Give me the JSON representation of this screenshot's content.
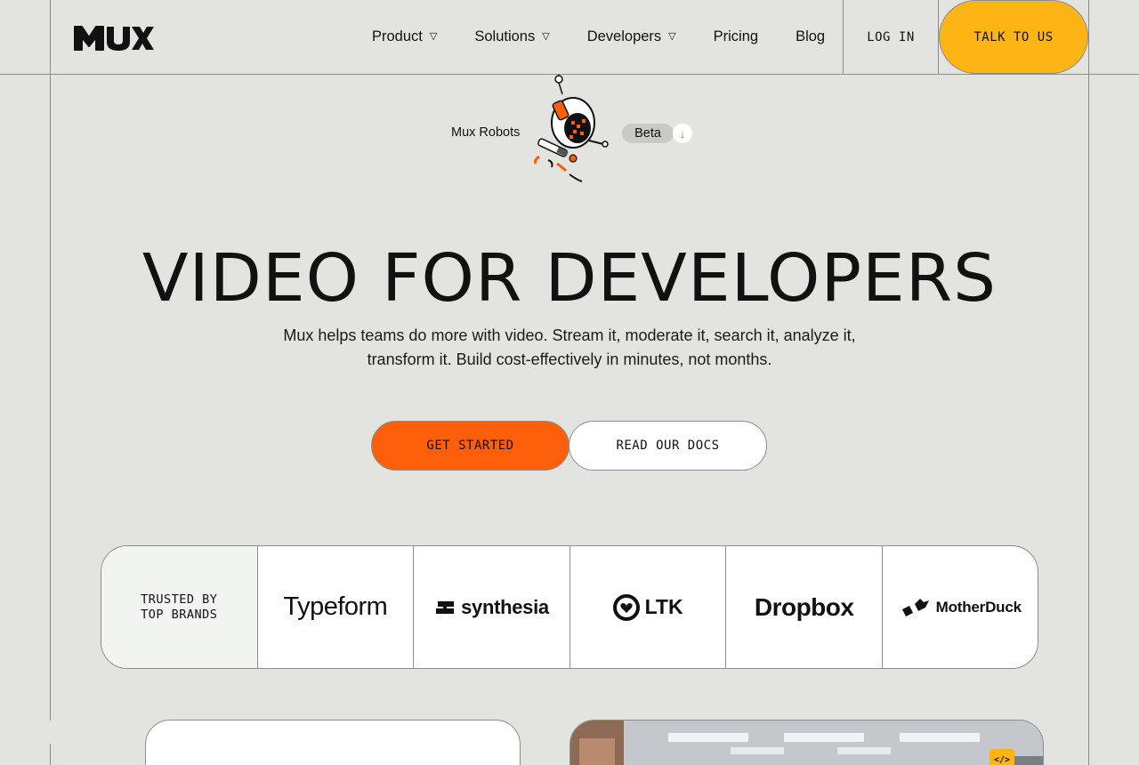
{
  "header": {
    "nav": [
      {
        "label": "Product",
        "caret": "▽"
      },
      {
        "label": "Solutions",
        "caret": "▽"
      },
      {
        "label": "Developers",
        "caret": "▽"
      },
      {
        "label": "Pricing"
      },
      {
        "label": "Blog"
      }
    ],
    "login_label": "LOG IN",
    "talk_label": "TALK TO US"
  },
  "robots": {
    "label": "Mux Robots",
    "badge": "Beta",
    "arrow": "↓"
  },
  "hero": {
    "title": "VIDEO FOR DEVELOPERS",
    "subtitle_line1": "Mux helps teams do more with video. Stream it, moderate it, search it, analyze it,",
    "subtitle_line2": "transform it. Build cost-effectively in minutes, not months.",
    "primary_cta": "GET STARTED",
    "secondary_cta": "READ OUR DOCS"
  },
  "brands": {
    "lead_line1": "TRUSTED BY",
    "lead_line2": "TOP BRANDS",
    "logos": [
      "Typeform",
      "synthesia",
      "LTK",
      "Dropbox",
      "MotherDuck"
    ]
  },
  "code_badge": "</>",
  "colors": {
    "background": "#e3e4df",
    "accent_orange": "#fb5f0a",
    "accent_yellow": "#fdb515",
    "border": "#8a8d93"
  }
}
